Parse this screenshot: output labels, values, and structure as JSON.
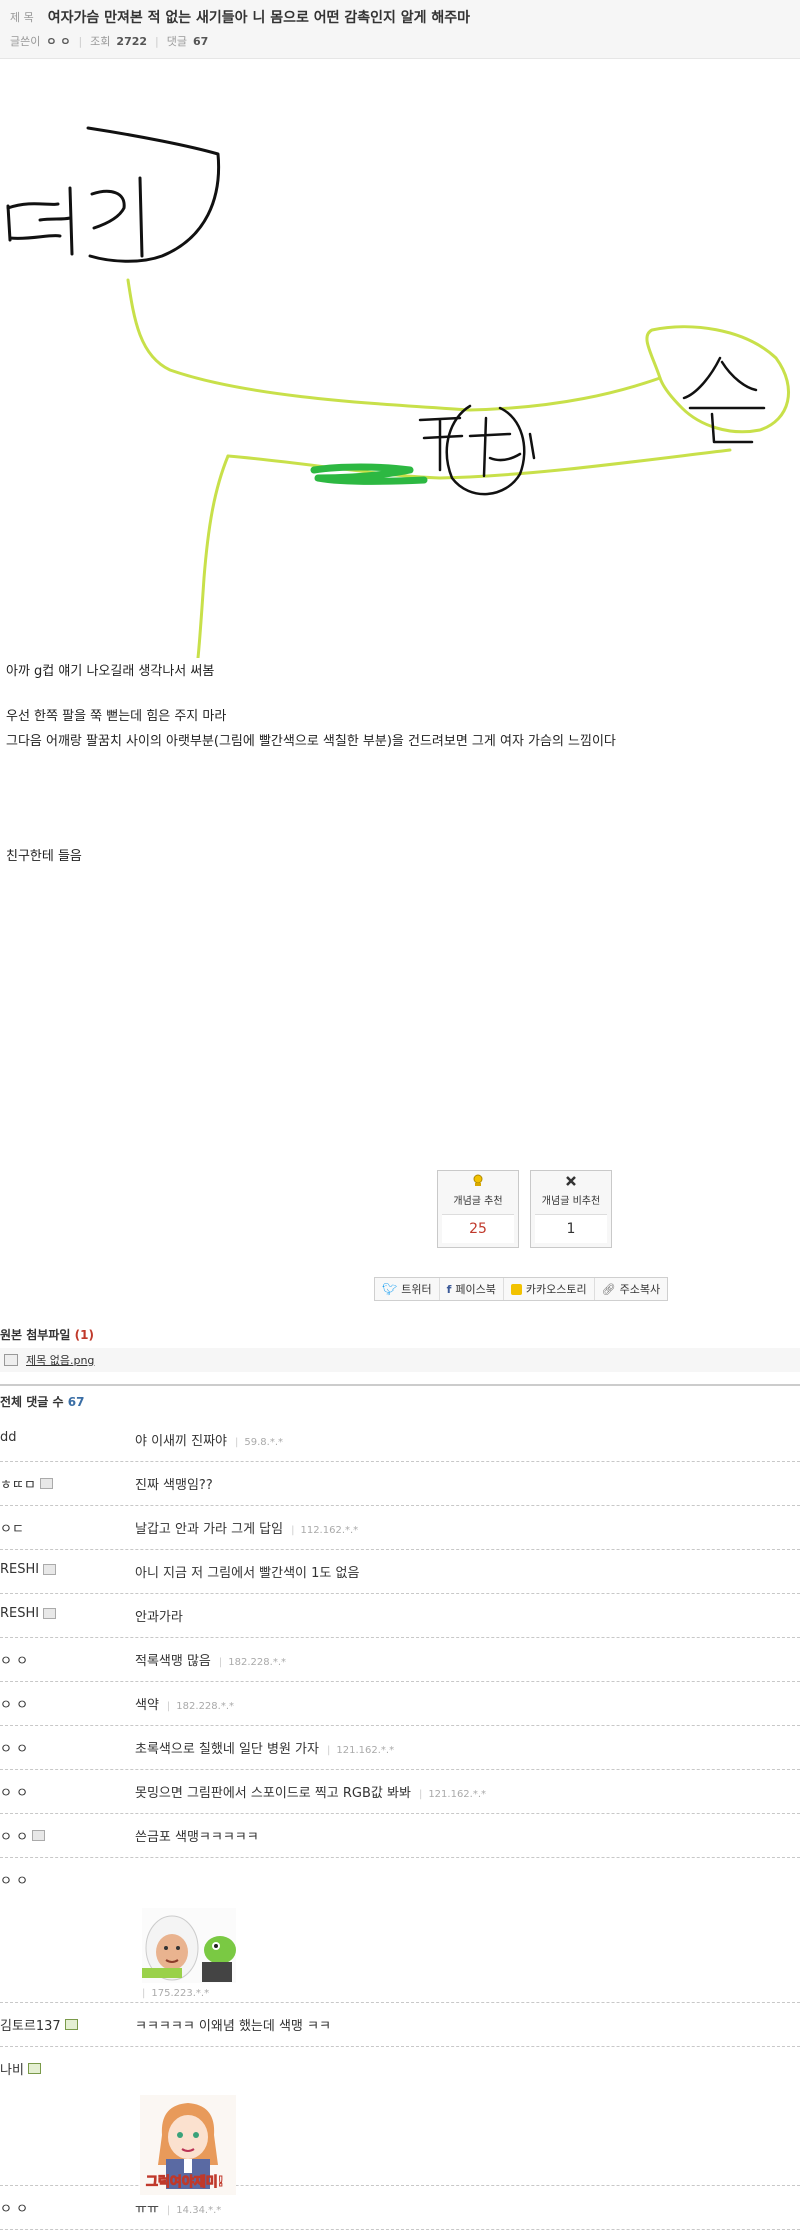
{
  "post": {
    "title_label": "제 목",
    "title": "여자가슴 만져본 적 없는 새기들아 니 몸으로 어떤 감촉인지 알게 해주마",
    "author_label": "글쓴이",
    "author": "ㅇ ㅇ",
    "views_label": "조회",
    "views": "2722",
    "comments_label": "댓글",
    "comments_count": "67"
  },
  "drawing": {
    "head_label": "머리",
    "hand_label": "손",
    "armpit_label": "팔꿈치",
    "colors": {
      "arm": "#c8e04a",
      "marked": "#2db842",
      "ink": "#111111"
    }
  },
  "body": {
    "line1": "아까 g컵 얘기 나오길래 생각나서 써봄",
    "line2": "우선 한쪽 팔을 쭉 뻗는데 힘은 주지 마라",
    "line3": "그다음 어깨랑 팔꿈치 사이의 아랫부분(그림에 빨간색으로 색칠한 부분)을 건드려보면 그게 여자 가슴의 느낌이다",
    "line4": "친구한테 들음"
  },
  "vote": {
    "up_label": "개념글 추천",
    "up_count": "25",
    "down_label": "개념글 비추천",
    "down_count": "1"
  },
  "share": {
    "twitter": "트위터",
    "facebook": "페이스북",
    "kakao": "카카오스토리",
    "copy": "주소복사"
  },
  "attachment": {
    "title": "원본 첨부파일",
    "count": "(1)",
    "file": "제목 없음.png"
  },
  "comment_section": {
    "title": "전체 댓글 수",
    "count": "67"
  },
  "comments": [
    {
      "nick": "dd",
      "text": "야 이새끼 진짜야",
      "ip": "59.8.*.*"
    },
    {
      "nick": "ㅎㄸㅁ",
      "text": "진짜 색맹임??",
      "ip": ""
    },
    {
      "nick": "ㅇㄷ",
      "text": "날갑고 안과 가라 그게 답임",
      "ip": "112.162.*.*"
    },
    {
      "nick": "RESHI",
      "text": "아니 지금 저 그림에서 빨간색이 1도 없음",
      "ip": ""
    },
    {
      "nick": "RESHI",
      "text": "안과가라",
      "ip": ""
    },
    {
      "nick": "ㅇ ㅇ",
      "text": "적록색맹 많음",
      "ip": "182.228.*.*"
    },
    {
      "nick": "ㅇ ㅇ",
      "text": "색약",
      "ip": "182.228.*.*"
    },
    {
      "nick": "ㅇ ㅇ",
      "text": "초록색으로 칠했네 일단 병원 가자",
      "ip": "121.162.*.*"
    },
    {
      "nick": "ㅇ ㅇ",
      "text": "못밍으면 그림판에서 스포이드로 찍고 RGB값 봐봐",
      "ip": "121.162.*.*"
    },
    {
      "nick": "ㅇ ㅇ",
      "text": "쓴금포 색맹ㅋㅋㅋㅋㅋ",
      "ip": ""
    },
    {
      "nick": "ㅇ ㅇ",
      "text": "",
      "ip": "175.223.*.*"
    },
    {
      "nick": "김토르137",
      "text": "ㅋㅋㅋㅋㅋ 이왜념 했는데 색맹 ㅋㅋ",
      "ip": ""
    },
    {
      "nick": "나비",
      "text": "",
      "ip": "",
      "caption": "그럭여야재미!"
    },
    {
      "nick": "ㅇ ㅇ",
      "text": "ㅠㅠ",
      "ip": "14.34.*.*"
    }
  ]
}
